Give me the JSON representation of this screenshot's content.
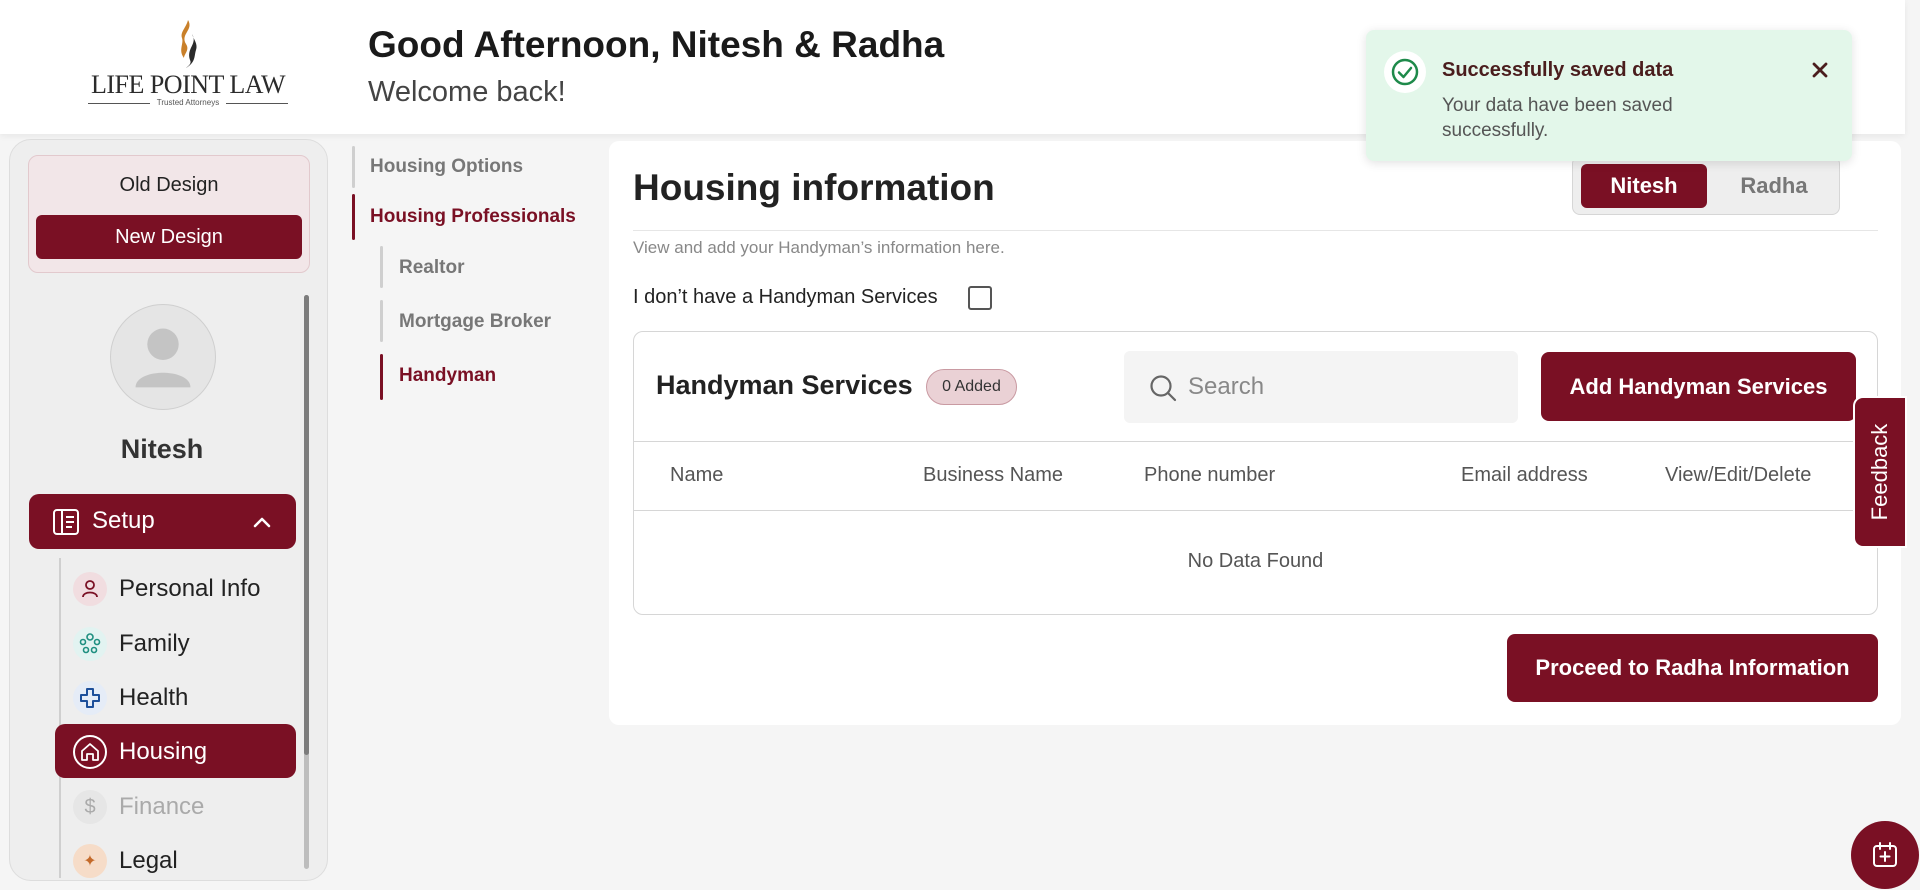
{
  "header": {
    "logo_text": "LIFE POINT LAW",
    "logo_tagline": "Trusted Attorneys",
    "greeting": "Good Afternoon, Nitesh & Radha",
    "welcome": "Welcome back!"
  },
  "toast": {
    "title": "Successfully saved data",
    "message": "Your data have been saved successfully.",
    "icon": "check-circle-icon",
    "close_icon": "close-icon"
  },
  "sidebar": {
    "old_design_label": "Old Design",
    "new_design_label": "New Design",
    "user_name": "Nitesh",
    "setup_label": "Setup",
    "items": [
      {
        "label": "Personal Info",
        "icon": "person-icon"
      },
      {
        "label": "Family",
        "icon": "family-icon"
      },
      {
        "label": "Health",
        "icon": "health-cross-icon"
      },
      {
        "label": "Housing",
        "icon": "house-icon"
      },
      {
        "label": "Finance",
        "icon": "dollar-icon"
      },
      {
        "label": "Legal",
        "icon": "legal-icon"
      }
    ]
  },
  "subnav": {
    "housing_options": "Housing Options",
    "housing_professionals": "Housing Professionals",
    "realtor": "Realtor",
    "mortgage_broker": "Mortgage Broker",
    "handyman": "Handyman"
  },
  "main": {
    "title": "Housing information",
    "toggle": {
      "primary": "Nitesh",
      "secondary": "Radha"
    },
    "description": "View and add your Handyman’s information here.",
    "no_handyman_label": "I don’t have a Handyman Services",
    "card": {
      "title": "Handyman Services",
      "badge": "0 Added",
      "search_placeholder": "Search",
      "add_button": "Add Handyman Services",
      "columns": [
        "Name",
        "Business Name",
        "Phone number",
        "Email address",
        "View/Edit/Delete"
      ],
      "empty_text": "No Data Found"
    },
    "proceed_button": "Proceed to Radha Information"
  },
  "feedback_label": "Feedback",
  "colors": {
    "brand": "#7a1024",
    "toast_bg": "#e3f7ea",
    "success": "#1e8a4a"
  }
}
